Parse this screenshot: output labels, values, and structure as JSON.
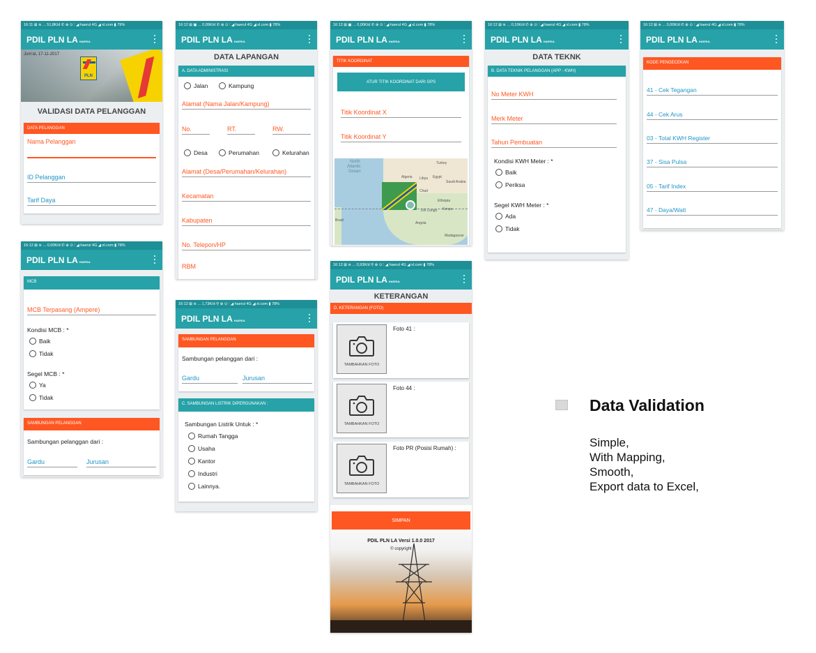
{
  "app": {
    "title": "PDIL PLN LA",
    "subtitle": "HAERUL"
  },
  "status": {
    "s1": "16:11 ⊠ ≋ ... 51,8K/d ✆ ⊕ ⊙ ⫶ ◢ haerul 4G ◢ xl.com ▮ 79%",
    "s2": "16:12 ⊠ ▣ ... 0,09K/d ✆ ⊕ ⊙ ⫶ ◢ haerul 4G ◢ xl.com ▮ 78%",
    "s3": "16:12 ⊠ ▣ ... 0,00K/d ✆ ⊕ ⊙ ⫶ ◢ haerul 4G ◢ xl.com ▮ 78%",
    "s4": "16:12 ⊠ ≋ ... 0,10K/d ✆ ⊕ ⊙ ⫶ ◢ haerul 4G ◢ xl.com ▮ 78%",
    "s5": "16:12 ⊠ ≋ ... 0,00K/d ✆ ⊕ ⊙ ⫶ ◢ haerul 4G ◢ xl.com ▮ 78%",
    "s6": "16:12 ⊠ ≋ ... 0,00K/d ✆ ⊕ ⊙ ⫶ ◢ haerul 4G ◢ xl.com ▮ 78%",
    "s7": "16:12 ⊠ ≋ ... 1,73K/d ⚲ ⊕ ⊙ ⫶ ◢ haerul 4G ◢ xl.com ▮ 78%",
    "s8": "16:12 ⊠ ≋ ... 0,93K/d ⚲ ⊕ ⊙ ⫶ ◢ haerul 4G ◢ xl.com ▮ 78%"
  },
  "s1": {
    "banner_date": "Jum'at, 17-11-2017",
    "logo_text": "PLN",
    "title": "VALIDASI DATA PELANGGAN",
    "header": "DATA PELANGGAN",
    "f1": "Nama Pelanggan",
    "f2": "ID Pelanggan",
    "f3": "Tarif Daya"
  },
  "s2": {
    "title": "DATA LAPANGAN",
    "header": "A. DATA ADMINISTRASI",
    "r1": "Jalan",
    "r2": "Kampung",
    "f1": "Alamat (Nama Jalan/Kampung)",
    "no": "No.",
    "rt": "RT.",
    "rw": "RW.",
    "r3": "Desa",
    "r4": "Perumahan",
    "r5": "Kelurahan",
    "f2": "Alamat (Desa/Perumahan/Kelurahan)",
    "f3": "Kecamatan",
    "f4": "Kabupaten",
    "f5": "No. Telepon/HP",
    "f6": "RBM"
  },
  "s3": {
    "header": "TITIK KOORDINAT",
    "button": "ATUR TITIK KOORDINAT DARI GPS",
    "f1": "Titik Koordinat X",
    "f2": "Titik Koordinat Y",
    "map": {
      "north": "North",
      "atlantic": "Atlantic",
      "ocean": "Ocean",
      "turkey": "Turkey",
      "algeria": "Algeria",
      "libya": "Libya",
      "egypt": "Egypt",
      "saudi": "Saudi Arabia",
      "chad": "Chad",
      "ethiopia": "Ethiopia",
      "kenya": "Kenya",
      "drc": "DR Congo",
      "angola": "Angola",
      "madagascar": "Madagascar",
      "brazil": "Brazil"
    }
  },
  "s4": {
    "title": "DATA TEKNK",
    "header": "B. DATA TEKNIK PELANGGAN  (APP - KWH)",
    "f1": "No Meter KWH",
    "f2": "Merk Meter",
    "f3": "Tahun Pembuatan",
    "l1": "Kondisi KWH Meter : *",
    "r1": "Baik",
    "r2": "Periksa",
    "l2": "Segel KWH Meter : *",
    "r3": "Ada",
    "r4": "Tidak"
  },
  "s5": {
    "header": "KODE PENGECEKAN",
    "items": [
      "41 - Cek Tegangan",
      "44 - Cek Arus",
      "03 - Total KWH Register",
      "37 - Sisa Pulsa",
      "05 - Tarif Index",
      "47 - Daya/Watt"
    ]
  },
  "s6": {
    "header": "MCB",
    "f1": "MCB Terpasang (Ampere)",
    "l1": "Kondisi MCB : *",
    "r1": "Baik",
    "r2": "Tidak",
    "l2": "Segel MCB : *",
    "r3": "Ya",
    "r4": "Tidak",
    "header2": "SAMBUNGAN PELANGGAN",
    "l3": "Sambungan pelanggan dari :",
    "f2": "Gardu",
    "f3": "Jurusan"
  },
  "s7": {
    "header": "SAMBUNGAN PELANGGAN",
    "l1": "Sambungan pelanggan dari :",
    "f1": "Gardu",
    "f2": "Jurusan",
    "header2": "C. SAMBUNGAN LISTRIK DIPERGUNAKAN :",
    "l2": "Sambungan Listrik Untuk : *",
    "r1": "Rumah Tangga",
    "r2": "Usaha",
    "r3": "Kantor",
    "r4": "Industri",
    "r5": "Lainnya."
  },
  "s8": {
    "title": "KETERANGAN",
    "header": "D. KETERANGAN (FOTO)",
    "add": "TAMBAHKAN FOTO",
    "p1": "Foto 41 :",
    "p2": "Foto 44 :",
    "p3": "Foto PR (Posisi Rumah) :",
    "save": "SIMPAN",
    "version": "PDIL PLN LA Versi 1.0.0  2017",
    "copyright": "© copyright"
  },
  "feature": {
    "title": "Data Validation",
    "lines": [
      "Simple,",
      "With Mapping,",
      "Smooth,",
      "Export data to Excel,"
    ]
  },
  "colors": {
    "teal": "#26a2a8",
    "orange": "#ff5722"
  }
}
